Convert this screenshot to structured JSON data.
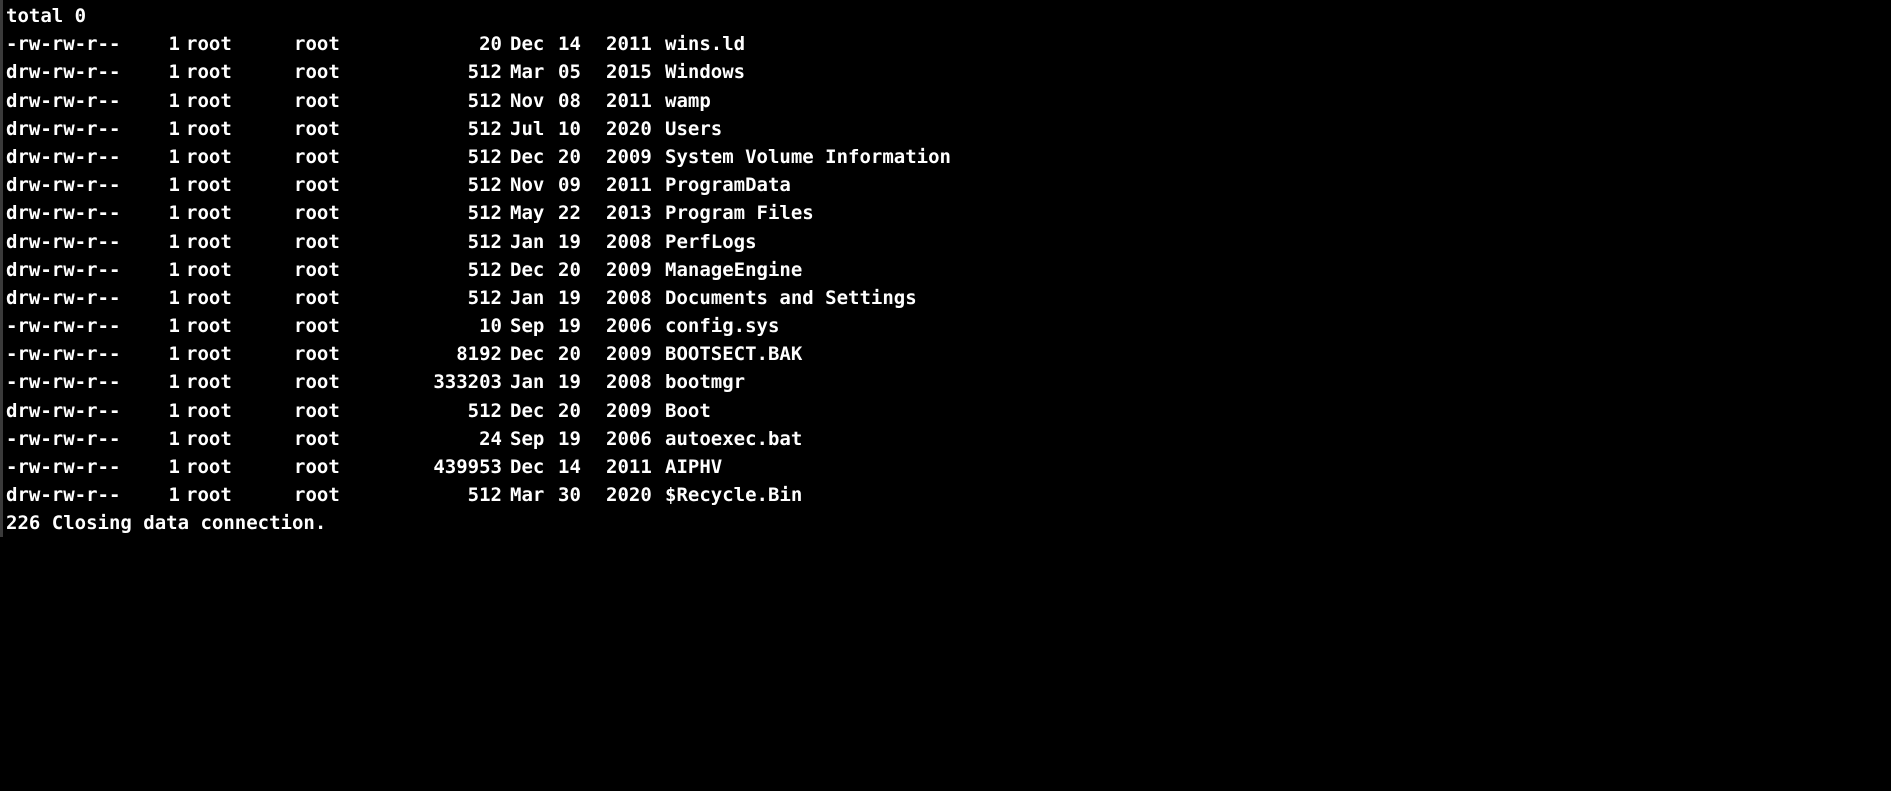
{
  "terminal": {
    "header": "total 0",
    "entries": [
      {
        "perms": "-rw-rw-r--",
        "links": "1",
        "owner": "root",
        "group": "root",
        "size": "20",
        "month": "Dec",
        "day": "14",
        "year": "2011",
        "name": "wins.ld"
      },
      {
        "perms": "drw-rw-r--",
        "links": "1",
        "owner": "root",
        "group": "root",
        "size": "512",
        "month": "Mar",
        "day": "05",
        "year": "2015",
        "name": "Windows"
      },
      {
        "perms": "drw-rw-r--",
        "links": "1",
        "owner": "root",
        "group": "root",
        "size": "512",
        "month": "Nov",
        "day": "08",
        "year": "2011",
        "name": "wamp"
      },
      {
        "perms": "drw-rw-r--",
        "links": "1",
        "owner": "root",
        "group": "root",
        "size": "512",
        "month": "Jul",
        "day": "10",
        "year": "2020",
        "name": "Users"
      },
      {
        "perms": "drw-rw-r--",
        "links": "1",
        "owner": "root",
        "group": "root",
        "size": "512",
        "month": "Dec",
        "day": "20",
        "year": "2009",
        "name": "System Volume Information"
      },
      {
        "perms": "drw-rw-r--",
        "links": "1",
        "owner": "root",
        "group": "root",
        "size": "512",
        "month": "Nov",
        "day": "09",
        "year": "2011",
        "name": "ProgramData"
      },
      {
        "perms": "drw-rw-r--",
        "links": "1",
        "owner": "root",
        "group": "root",
        "size": "512",
        "month": "May",
        "day": "22",
        "year": "2013",
        "name": "Program Files"
      },
      {
        "perms": "drw-rw-r--",
        "links": "1",
        "owner": "root",
        "group": "root",
        "size": "512",
        "month": "Jan",
        "day": "19",
        "year": "2008",
        "name": "PerfLogs"
      },
      {
        "perms": "drw-rw-r--",
        "links": "1",
        "owner": "root",
        "group": "root",
        "size": "512",
        "month": "Dec",
        "day": "20",
        "year": "2009",
        "name": "ManageEngine"
      },
      {
        "perms": "drw-rw-r--",
        "links": "1",
        "owner": "root",
        "group": "root",
        "size": "512",
        "month": "Jan",
        "day": "19",
        "year": "2008",
        "name": "Documents and Settings"
      },
      {
        "perms": "-rw-rw-r--",
        "links": "1",
        "owner": "root",
        "group": "root",
        "size": "10",
        "month": "Sep",
        "day": "19",
        "year": "2006",
        "name": "config.sys"
      },
      {
        "perms": "-rw-rw-r--",
        "links": "1",
        "owner": "root",
        "group": "root",
        "size": "8192",
        "month": "Dec",
        "day": "20",
        "year": "2009",
        "name": "BOOTSECT.BAK"
      },
      {
        "perms": "-rw-rw-r--",
        "links": "1",
        "owner": "root",
        "group": "root",
        "size": "333203",
        "month": "Jan",
        "day": "19",
        "year": "2008",
        "name": "bootmgr"
      },
      {
        "perms": "drw-rw-r--",
        "links": "1",
        "owner": "root",
        "group": "root",
        "size": "512",
        "month": "Dec",
        "day": "20",
        "year": "2009",
        "name": "Boot"
      },
      {
        "perms": "-rw-rw-r--",
        "links": "1",
        "owner": "root",
        "group": "root",
        "size": "24",
        "month": "Sep",
        "day": "19",
        "year": "2006",
        "name": "autoexec.bat"
      },
      {
        "perms": "-rw-rw-r--",
        "links": "1",
        "owner": "root",
        "group": "root",
        "size": "439953",
        "month": "Dec",
        "day": "14",
        "year": "2011",
        "name": "AIPHV"
      },
      {
        "perms": "drw-rw-r--",
        "links": "1",
        "owner": "root",
        "group": "root",
        "size": "512",
        "month": "Mar",
        "day": "30",
        "year": "2020",
        "name": "$Recycle.Bin"
      }
    ],
    "footer": "226 Closing data connection."
  },
  "colors": {
    "background": "#000000",
    "text": "#ffffff"
  }
}
